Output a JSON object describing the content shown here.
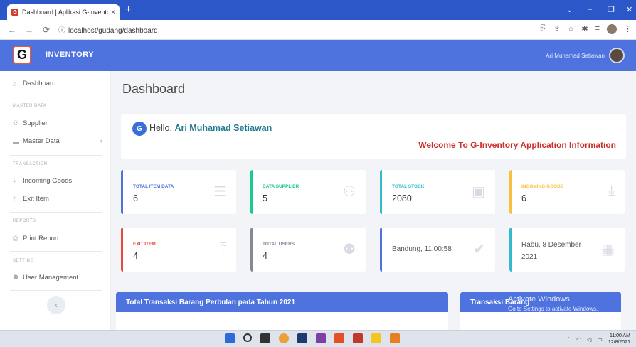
{
  "browser": {
    "tab_title": "Dashboard | Aplikasi G-Inventori",
    "tab_close": "×",
    "new_tab": "+",
    "url": "localhost/gudang/dashboard",
    "favicon_letter": "G",
    "win_controls": [
      "⌄",
      "–",
      "❐",
      "✕"
    ]
  },
  "topbar": {
    "brand_letter": "G",
    "brand_name": "INVENTORY",
    "user_name": "Ari Muhamad Setiawan"
  },
  "sidebar": {
    "dashboard": "Dashboard",
    "head_master": "MASTER DATA",
    "supplier": "Supplier",
    "master_data": "Master Data",
    "head_transaction": "TRANSACTION",
    "incoming": "Incoming Goods",
    "exit": "Exit Item",
    "head_reports": "REPORTS",
    "print": "Print Report",
    "head_setting": "SETTING",
    "users": "User Management",
    "toggle": "‹"
  },
  "main": {
    "title": "Dashboard",
    "hello_prefix": "Hello, ",
    "hello_name": "Ari Muhamad Setiawan",
    "welcome": "Welcome To G-Inventory Application Information"
  },
  "cards": {
    "total_item_label": "TOTAL ITEM DATA",
    "total_item_value": "6",
    "supplier_label": "DATA SUPPLIER",
    "supplier_value": "5",
    "stock_label": "TOTAL STOCK",
    "stock_value": "2080",
    "incoming_label": "INCOMING GOODS",
    "incoming_value": "6",
    "exit_label": "EXIT ITEM",
    "exit_value": "4",
    "users_label": "TOTAL USERS",
    "users_value": "4",
    "location_time": "Bandung, 11:00:58",
    "date_line1": "Rabu, 8 Desember",
    "date_line2": "2021"
  },
  "panels": {
    "monthly": "Total Transaksi Barang Perbulan pada Tahun 2021",
    "transaksi": "Transaksi Barang"
  },
  "watermark": {
    "title": "Activate Windows",
    "sub": "Go to Settings to activate Windows."
  },
  "taskbar": {
    "time": "11:00 AM",
    "date": "12/8/2021"
  },
  "colors": {
    "primary": "#4e73df",
    "success": "#1cc88a",
    "info": "#36b9cc",
    "warning": "#f6c23e",
    "danger": "#e74a3b",
    "secondary": "#858796"
  }
}
